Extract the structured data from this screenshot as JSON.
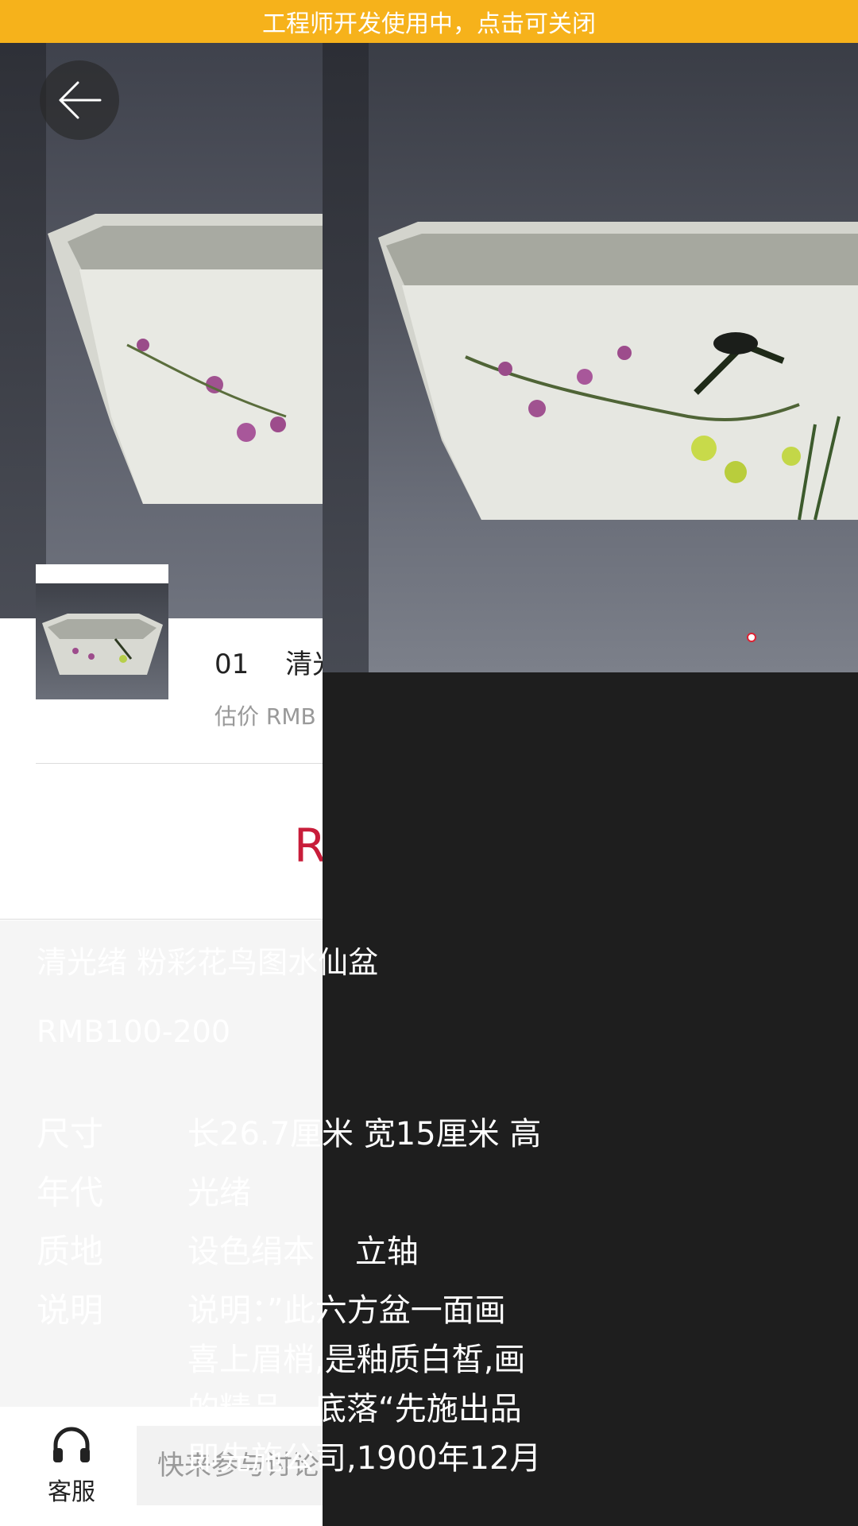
{
  "banner": {
    "text": "工程师开发使用中，点击可关闭"
  },
  "list": {
    "lot_number": "01",
    "title_fragment": "清光",
    "estimate_fragment": "估价 RMB",
    "red_fragment": "R"
  },
  "bottom": {
    "service_label": "客服",
    "comment_placeholder": "快来参与讨论"
  },
  "detail": {
    "lot": "01",
    "title": "清光绪 粉彩花鸟图水仙盆",
    "price": "RMB100-200",
    "specs": [
      {
        "key": "尺寸",
        "value": "长26.7厘米 宽15厘米 高"
      },
      {
        "key": "年代",
        "value": "光绪"
      },
      {
        "key": "质地",
        "value": "设色绢本    立轴"
      }
    ],
    "description": {
      "key": "说明",
      "lines": [
        "说明：”此六方盆一面画",
        "喜上眉梢,是釉质白皙,画",
        "的精品。底落“先施出品",
        "即先施公司,1900年12月"
      ]
    }
  },
  "colors": {
    "banner": "#f6b21b",
    "accent_red": "#c81d3a",
    "panel_bg": "#1e1e1e"
  }
}
